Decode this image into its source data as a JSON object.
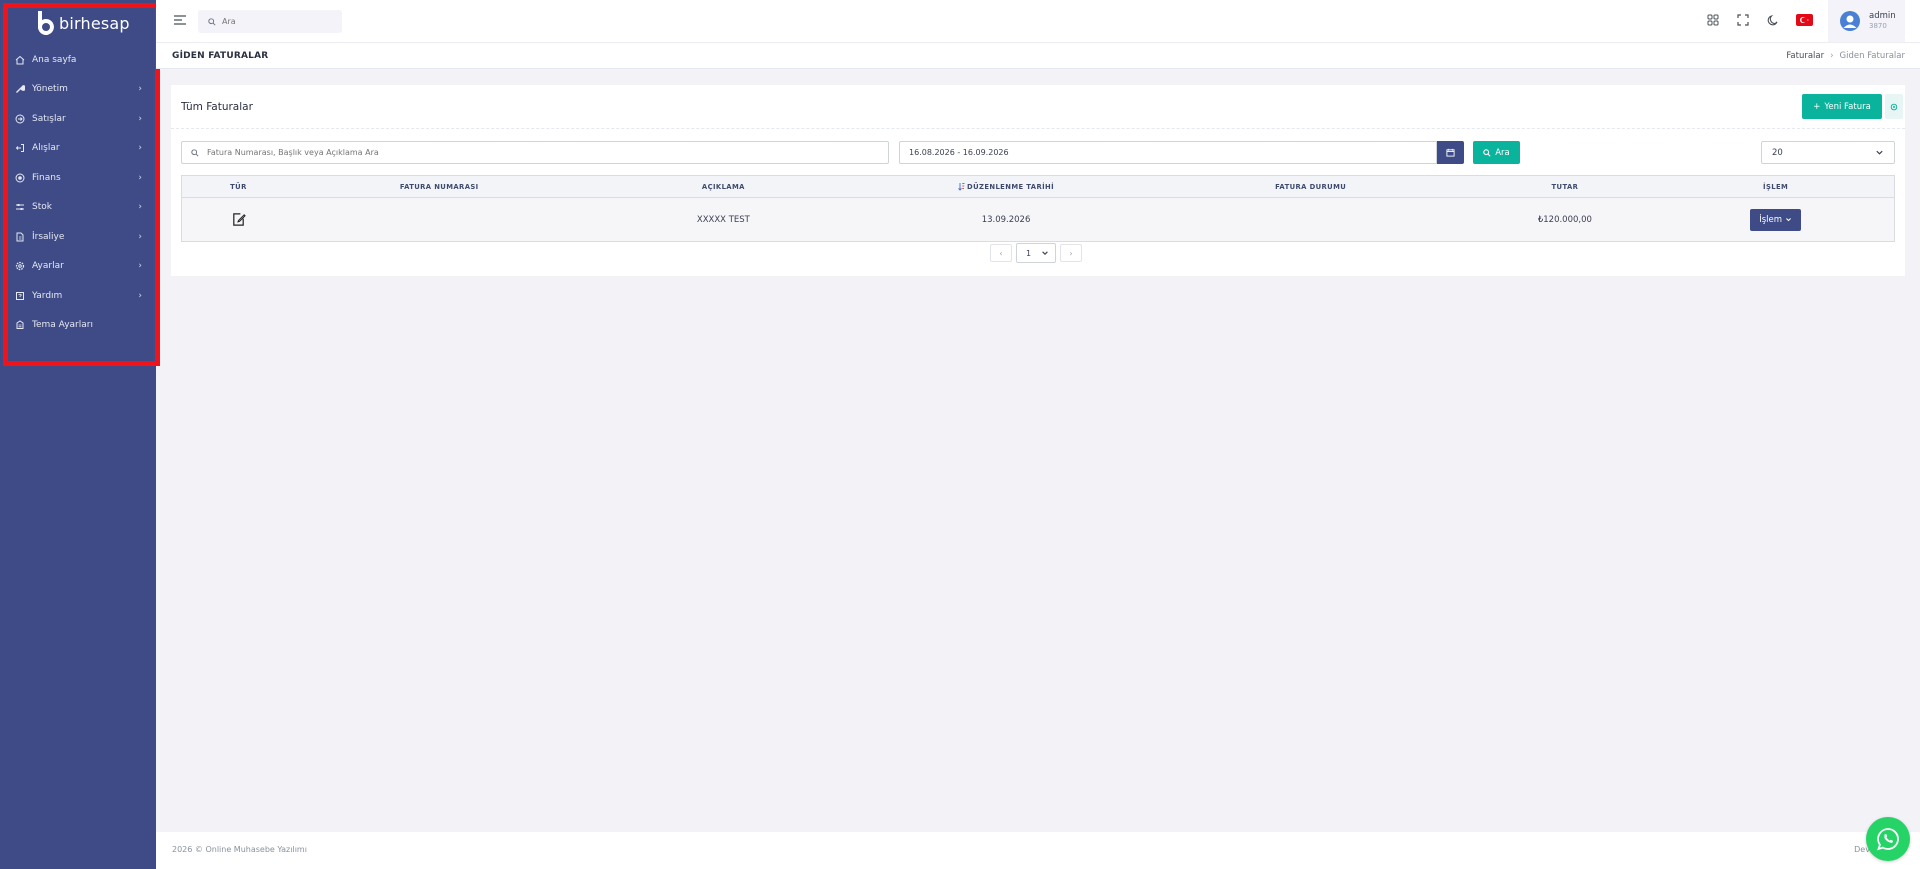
{
  "brand": {
    "name": "birhesap"
  },
  "sidebar": {
    "items": [
      {
        "label": "Ana sayfa",
        "icon": "home-icon",
        "has_submenu": false
      },
      {
        "label": "Yönetim",
        "icon": "wrench-icon",
        "has_submenu": true
      },
      {
        "label": "Satışlar",
        "icon": "sign-in-icon",
        "has_submenu": true
      },
      {
        "label": "Alışlar",
        "icon": "sign-out-icon",
        "has_submenu": true
      },
      {
        "label": "Finans",
        "icon": "coin-icon",
        "has_submenu": true
      },
      {
        "label": "Stok",
        "icon": "sliders-icon",
        "has_submenu": true
      },
      {
        "label": "İrsaliye",
        "icon": "file-icon",
        "has_submenu": true
      },
      {
        "label": "Ayarlar",
        "icon": "gear-icon",
        "has_submenu": true
      },
      {
        "label": "Yardım",
        "icon": "help-book-icon",
        "has_submenu": true
      },
      {
        "label": "Tema Ayarları",
        "icon": "palette-icon",
        "has_submenu": false
      }
    ],
    "chevron": "›"
  },
  "topbar": {
    "search_placeholder": "Ara",
    "user": {
      "name": "admin",
      "id": "3870"
    }
  },
  "page": {
    "title": "GİDEN FATURALAR",
    "breadcrumb": [
      "Faturalar",
      "Giden Faturalar"
    ],
    "breadcrumb_sep": "›"
  },
  "card": {
    "title": "Tüm Faturalar",
    "new_button": "Yeni Fatura",
    "new_button_icon": "+",
    "filter_placeholder": "Fatura Numarası, Başlık veya Açıklama Ara",
    "date_range": "16.08.2026 - 16.09.2026",
    "search_button": "Ara",
    "page_size": "20"
  },
  "table": {
    "columns": [
      "TÜR",
      "FATURA NUMARASI",
      "AÇIKLAMA",
      "DÜZENLENME TARİHİ",
      "FATURA DURUMU",
      "TUTAR",
      "İŞLEM"
    ],
    "rows": [
      {
        "type_icon": "edit-document-icon",
        "number": "",
        "description": "XXXXX TEST",
        "date": "13.09.2026",
        "status": "",
        "amount": "₺120.000,00",
        "action": "İşlem"
      }
    ]
  },
  "pagination": {
    "prev": "‹",
    "current": "1",
    "next": "›"
  },
  "footer": {
    "left": "2026 © Online Muhasebe Yazılımı",
    "right": "Develope"
  },
  "colors": {
    "sidebar": "#3e4b87",
    "accent": "#0ab39c",
    "primary": "#3e4b87",
    "highlight": "#f0141a"
  }
}
